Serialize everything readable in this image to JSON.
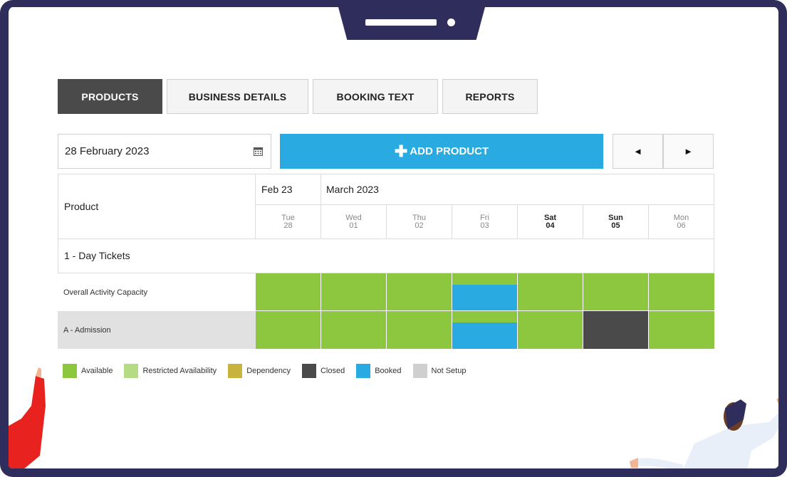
{
  "tabs": [
    {
      "label": "PRODUCTS",
      "active": true
    },
    {
      "label": "BUSINESS DETAILS",
      "active": false
    },
    {
      "label": "BOOKING TEXT",
      "active": false
    },
    {
      "label": "REPORTS",
      "active": false
    }
  ],
  "toolbar": {
    "date_value": "28 February 2023",
    "add_product_label": "ADD PRODUCT",
    "prev_glyph": "◄",
    "next_glyph": "►"
  },
  "calendar": {
    "product_header": "Product",
    "month_feb": "Feb 23",
    "month_mar": "March 2023",
    "days": [
      {
        "dow": "Tue",
        "num": "28"
      },
      {
        "dow": "Wed",
        "num": "01"
      },
      {
        "dow": "Thu",
        "num": "02"
      },
      {
        "dow": "Fri",
        "num": "03"
      },
      {
        "dow": "Sat",
        "num": "04"
      },
      {
        "dow": "Sun",
        "num": "05"
      },
      {
        "dow": "Mon",
        "num": "06"
      }
    ],
    "group_label": "1 - Day Tickets",
    "rows": [
      {
        "label": "Overall Activity Capacity"
      },
      {
        "label": "A - Admission"
      }
    ]
  },
  "legend": [
    {
      "label": "Available",
      "color": "#8dc63f"
    },
    {
      "label": "Restricted Availability",
      "color": "#b5dc84"
    },
    {
      "label": "Dependency",
      "color": "#c8b33f"
    },
    {
      "label": "Closed",
      "color": "#4a4a4a"
    },
    {
      "label": "Booked",
      "color": "#29abe2"
    },
    {
      "label": "Not Setup",
      "color": "#cfcfcf"
    }
  ]
}
